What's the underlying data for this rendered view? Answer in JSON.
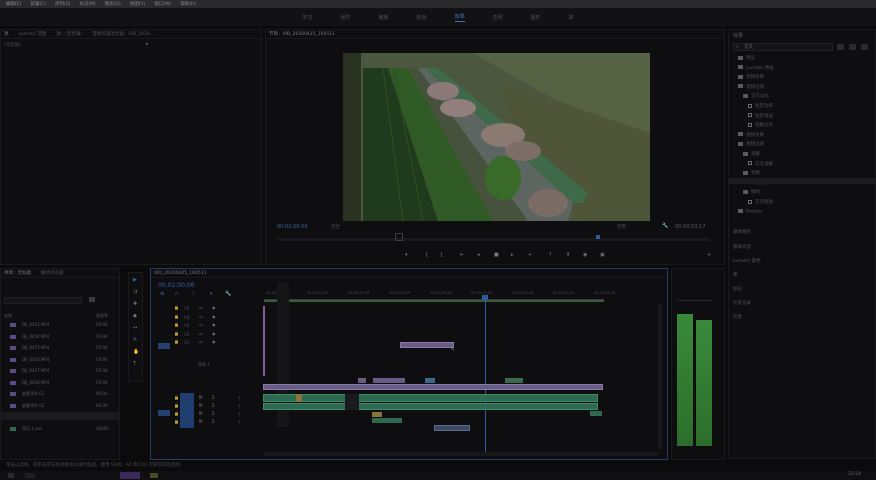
{
  "menu": [
    "编辑(E)",
    "剪辑(C)",
    "序列(S)",
    "标记(M)",
    "图形(G)",
    "视图(V)",
    "窗口(W)",
    "帮助(H)"
  ],
  "workspace": {
    "tabs": [
      "学习",
      "组件",
      "编辑",
      "颜色",
      "效果",
      "音频",
      "图形",
      "库"
    ],
    "active_index": 4
  },
  "source_panel": {
    "tabs": [
      "源",
      "Lumetri 范围",
      "源：(无剪辑)",
      "音频剪辑混合器：VID_2020..."
    ],
    "empty_label": "(无剪辑)"
  },
  "program": {
    "tab": "节目：VID_20200425_160511",
    "current_time": "00;02;00;06",
    "fit": "适合",
    "quality": "完整",
    "duration": "00;00;03;17"
  },
  "effects_panel": {
    "title": "效果",
    "search_value": "交叉",
    "items": [
      {
        "label": "预设",
        "kind": "folder",
        "indent": 1
      },
      {
        "label": "Lumetri 预设",
        "kind": "folder",
        "indent": 1
      },
      {
        "label": "音频效果",
        "kind": "folder",
        "indent": 1
      },
      {
        "label": "音频过渡",
        "kind": "folder",
        "indent": 1
      },
      {
        "label": "交叉淡化",
        "kind": "folder",
        "indent": 2
      },
      {
        "label": "恒定功率",
        "kind": "fx",
        "indent": 3
      },
      {
        "label": "恒定增益",
        "kind": "fx",
        "indent": 3
      },
      {
        "label": "指数淡化",
        "kind": "fx",
        "indent": 3
      },
      {
        "label": "视频效果",
        "kind": "folder",
        "indent": 1
      },
      {
        "label": "视频过渡",
        "kind": "folder",
        "indent": 1
      },
      {
        "label": "溶解",
        "kind": "folder",
        "indent": 2
      },
      {
        "label": "交叉溶解",
        "kind": "fx",
        "indent": 3
      },
      {
        "label": "划像",
        "kind": "folder",
        "indent": 2
      },
      {
        "label": "交叉划像",
        "kind": "fx",
        "indent": 3
      },
      {
        "label": "擦除",
        "kind": "folder",
        "indent": 2
      },
      {
        "label": "交叉缩放",
        "kind": "fx",
        "indent": 3
      },
      {
        "label": "Presets",
        "kind": "folder",
        "indent": 1
      }
    ],
    "sections": [
      "基本图形",
      "基本声音",
      "Lumetri 颜色",
      "库",
      "标记",
      "历史记录",
      "信息"
    ]
  },
  "project_panel": {
    "tabs": [
      "项目：无标题",
      "媒体浏览器"
    ],
    "search_placeholder": "",
    "columns": [
      "名称",
      "帧速率"
    ],
    "items": [
      {
        "name": "DJI_0453.MP4",
        "rate": "59.94"
      },
      {
        "name": "DJI_0454.MP4",
        "rate": "59.94"
      },
      {
        "name": "DJI_0455.MP4",
        "rate": "59.94"
      },
      {
        "name": "DJI_0456.MP4",
        "rate": "59.94"
      },
      {
        "name": "DJI_0457.MP4",
        "rate": "59.94"
      },
      {
        "name": "DJI_0458.MP4",
        "rate": "59.94"
      },
      {
        "name": "嵌套序列 01",
        "rate": "60.00"
      },
      {
        "name": "嵌套序列 02",
        "rate": "60.00"
      },
      {
        "name": "VID_20200425_160511",
        "rate": "60.00"
      },
      {
        "name": "音乐 1.aac",
        "rate": "48000"
      }
    ]
  },
  "timeline": {
    "tab": "VID_20200425_160511",
    "timecode": "00;02;00;06",
    "ruler": [
      "00;00;00;00",
      "00;00;29;29",
      "00;00;59;28",
      "00;01;29;29",
      "00;01;59;28",
      "00;02;29;29",
      "00;02;59;28",
      "00;03;29;29",
      "00;03;59;28"
    ],
    "video_tracks": [
      "V5",
      "V4",
      "V3",
      "V2",
      "V1"
    ],
    "audio_tracks": [
      "A1",
      "A2",
      "A3",
      "A4"
    ],
    "track_label_v1": "视频 1"
  },
  "status_bar": "单击以选择，或单击空白处并拖动以进行框选。使用 Shift、Alt 和 Ctrl 可获得其他选项。",
  "clock": "23:24"
}
